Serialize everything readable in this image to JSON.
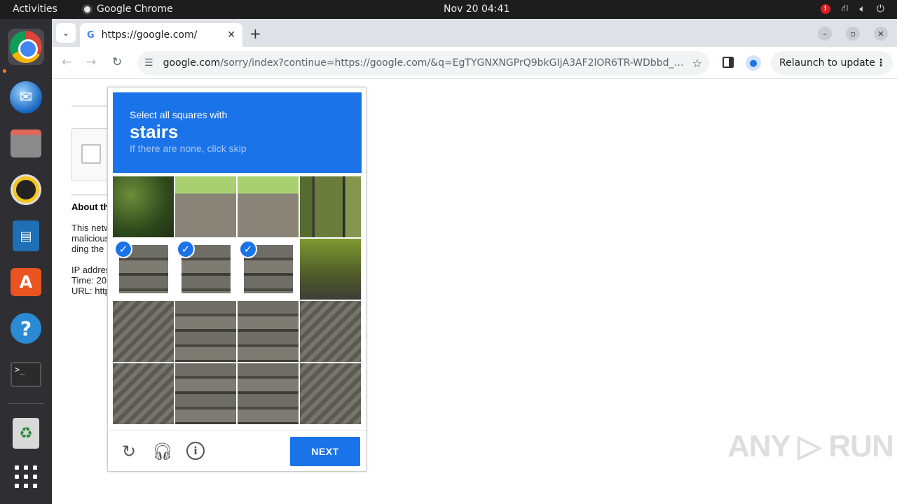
{
  "topbar": {
    "activities": "Activities",
    "app_name": "Google Chrome",
    "clock": "Nov 20  04:41",
    "alert": "!"
  },
  "dock": {
    "items": [
      "chrome-icon",
      "thunderbird-icon",
      "files-icon",
      "rhythmbox-icon",
      "writer-icon",
      "app-center-icon",
      "help-icon",
      "terminal-icon",
      "trash-icon",
      "show-apps-icon"
    ],
    "active_indicator_color": "#f08030"
  },
  "browser": {
    "tab_title": "https://google.com/",
    "tab_favicon": "G",
    "url_host": "google.com",
    "url_path": "/sorry/index?continue=https://google.com/&q=EgTYGNXNGPrQ9bkGIjA3AF2lOR6TR-WDbbd_VhjkDjwO…",
    "relaunch_label": "Relaunch to update"
  },
  "page": {
    "about_heading": "About th",
    "para_lines": [
      "This netw",
      "malicious",
      "ding the"
    ],
    "info_lines": [
      "IP addres",
      "Time: 20",
      "URL: http"
    ]
  },
  "captcha": {
    "instruction": "Select all squares with",
    "target": "stairs",
    "hint": "If there are none, click skip",
    "next_label": "NEXT",
    "accent": "#1a73e8",
    "tiles": [
      {
        "texture": "t-leaf",
        "selected": false
      },
      {
        "texture": "t-path",
        "selected": false
      },
      {
        "texture": "t-path",
        "selected": false
      },
      {
        "texture": "t-rail",
        "selected": false
      },
      {
        "texture": "t-stone",
        "selected": true
      },
      {
        "texture": "t-stone",
        "selected": true
      },
      {
        "texture": "t-stone",
        "selected": true
      },
      {
        "texture": "t-moss",
        "selected": false
      },
      {
        "texture": "t-wall",
        "selected": false
      },
      {
        "texture": "t-stone",
        "selected": false
      },
      {
        "texture": "t-stone",
        "selected": false
      },
      {
        "texture": "t-wall",
        "selected": false
      },
      {
        "texture": "t-wall",
        "selected": false
      },
      {
        "texture": "t-stone",
        "selected": false
      },
      {
        "texture": "t-stone",
        "selected": false
      },
      {
        "texture": "t-wall",
        "selected": false
      }
    ]
  },
  "watermark": "ANY ▷ RUN"
}
